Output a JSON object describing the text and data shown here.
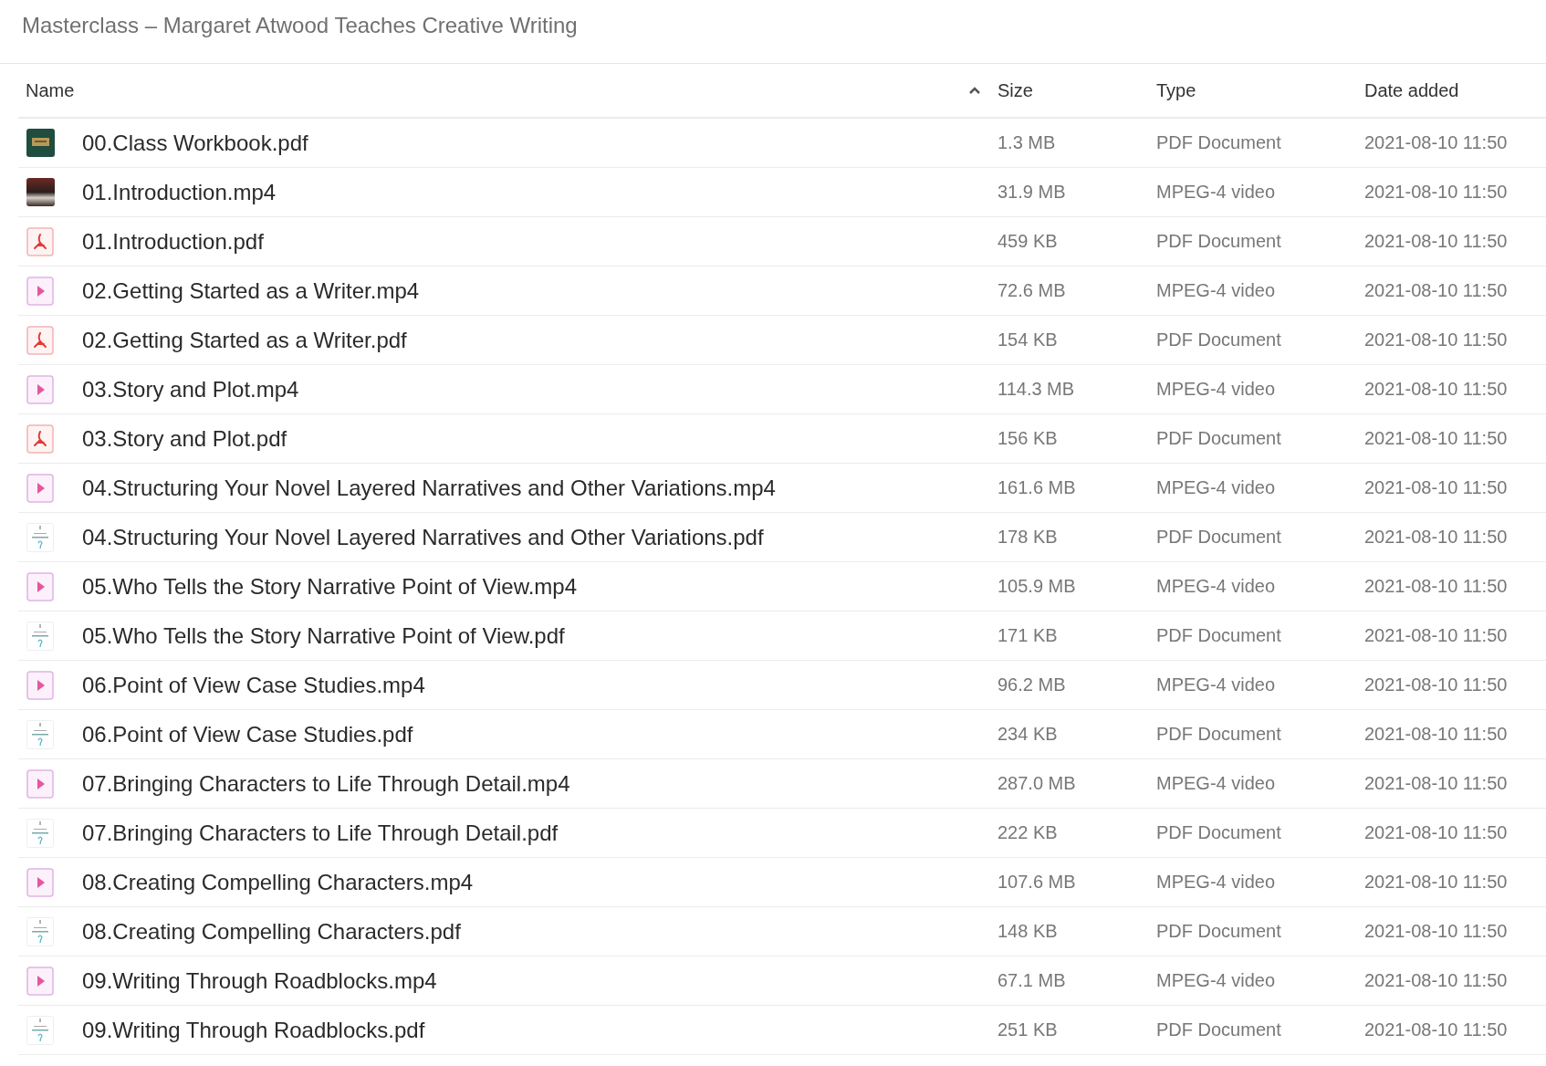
{
  "title": "Masterclass – Margaret Atwood Teaches Creative Writing",
  "columns": [
    {
      "label": "Name",
      "sorted": true
    },
    {
      "label": "Size",
      "sorted": false
    },
    {
      "label": "Type",
      "sorted": false
    },
    {
      "label": "Date added",
      "sorted": false
    }
  ],
  "rows": [
    {
      "kind": "workbook",
      "name": "00.Class Workbook.pdf",
      "size": "1.3 MB",
      "type": "PDF Document",
      "date": "2021-08-10 11:50"
    },
    {
      "kind": "photo",
      "name": "01.Introduction.mp4",
      "size": "31.9 MB",
      "type": "MPEG-4 video",
      "date": "2021-08-10 11:50"
    },
    {
      "kind": "pdf",
      "name": "01.Introduction.pdf",
      "size": "459 KB",
      "type": "PDF Document",
      "date": "2021-08-10 11:50"
    },
    {
      "kind": "video",
      "name": "02.Getting Started as a Writer.mp4",
      "size": "72.6 MB",
      "type": "MPEG-4 video",
      "date": "2021-08-10 11:50"
    },
    {
      "kind": "pdf",
      "name": "02.Getting Started as a Writer.pdf",
      "size": "154 KB",
      "type": "PDF Document",
      "date": "2021-08-10 11:50"
    },
    {
      "kind": "video",
      "name": "03.Story and Plot.mp4",
      "size": "114.3 MB",
      "type": "MPEG-4 video",
      "date": "2021-08-10 11:50"
    },
    {
      "kind": "pdf",
      "name": "03.Story and Plot.pdf",
      "size": "156 KB",
      "type": "PDF Document",
      "date": "2021-08-10 11:50"
    },
    {
      "kind": "video",
      "name": "04.Structuring Your Novel Layered Narratives and Other Variations.mp4",
      "size": "161.6 MB",
      "type": "MPEG-4 video",
      "date": "2021-08-10 11:50"
    },
    {
      "kind": "page",
      "name": "04.Structuring Your Novel Layered Narratives and Other Variations.pdf",
      "size": "178 KB",
      "type": "PDF Document",
      "date": "2021-08-10 11:50"
    },
    {
      "kind": "video",
      "name": "05.Who Tells the Story Narrative Point of View.mp4",
      "size": "105.9 MB",
      "type": "MPEG-4 video",
      "date": "2021-08-10 11:50"
    },
    {
      "kind": "page",
      "name": "05.Who Tells the Story Narrative Point of View.pdf",
      "size": "171 KB",
      "type": "PDF Document",
      "date": "2021-08-10 11:50"
    },
    {
      "kind": "video",
      "name": "06.Point of View Case Studies.mp4",
      "size": "96.2 MB",
      "type": "MPEG-4 video",
      "date": "2021-08-10 11:50"
    },
    {
      "kind": "page",
      "name": "06.Point of View Case Studies.pdf",
      "size": "234 KB",
      "type": "PDF Document",
      "date": "2021-08-10 11:50"
    },
    {
      "kind": "video",
      "name": "07.Bringing Characters to Life Through Detail.mp4",
      "size": "287.0 MB",
      "type": "MPEG-4 video",
      "date": "2021-08-10 11:50"
    },
    {
      "kind": "page",
      "name": "07.Bringing Characters to Life Through Detail.pdf",
      "size": "222 KB",
      "type": "PDF Document",
      "date": "2021-08-10 11:50"
    },
    {
      "kind": "video",
      "name": "08.Creating Compelling Characters.mp4",
      "size": "107.6 MB",
      "type": "MPEG-4 video",
      "date": "2021-08-10 11:50"
    },
    {
      "kind": "page",
      "name": "08.Creating Compelling Characters.pdf",
      "size": "148 KB",
      "type": "PDF Document",
      "date": "2021-08-10 11:50"
    },
    {
      "kind": "video",
      "name": "09.Writing Through Roadblocks.mp4",
      "size": "67.1 MB",
      "type": "MPEG-4 video",
      "date": "2021-08-10 11:50"
    },
    {
      "kind": "page",
      "name": "09.Writing Through Roadblocks.pdf",
      "size": "251 KB",
      "type": "PDF Document",
      "date": "2021-08-10 11:50"
    }
  ]
}
